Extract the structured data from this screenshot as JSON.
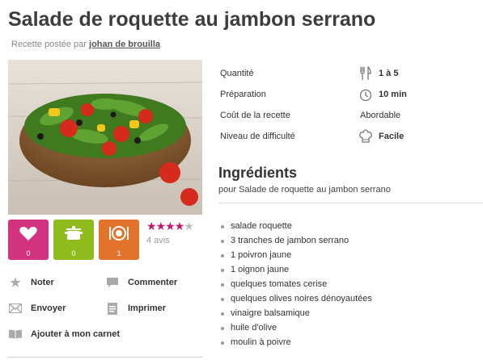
{
  "recipe": {
    "title": "Salade de roquette au jambon serrano",
    "posted_prefix": "Recette postée par",
    "author": "johan de brouilla"
  },
  "reactions": {
    "heart_count": "0",
    "pot_count": "0",
    "plate_count": "1",
    "rating": 3.5,
    "rating_max": 5,
    "reviews": "4 avis"
  },
  "actions": {
    "noter": "Noter",
    "commenter": "Commenter",
    "envoyer": "Envoyer",
    "imprimer": "Imprimer",
    "carnet": "Ajouter à mon carnet"
  },
  "info": {
    "quantite_label": "Quantité",
    "quantite_value": "1 à 5",
    "preparation_label": "Préparation",
    "preparation_value": "10 min",
    "cout_label": "Coût de la recette",
    "cout_value": "Abordable",
    "difficulte_label": "Niveau de difficulté",
    "difficulte_value": "Facile"
  },
  "ingredients": {
    "title": "Ingrédients",
    "subtitle": "pour Salade de roquette au jambon serrano",
    "items": [
      "salade roquette",
      "3 tranches de jambon serrano",
      "1 poivron jaune",
      "1 oignon jaune",
      "quelques tomates cerise",
      "quelques olives noires dénoyautées",
      "vinaigre balsamique",
      "huile d'olive",
      "moulin à poivre"
    ]
  },
  "colors": {
    "heart_tile": "#d2327f",
    "pot_tile": "#8fbb1c",
    "plate_tile": "#e3722b",
    "star_on": "#c2186b"
  }
}
